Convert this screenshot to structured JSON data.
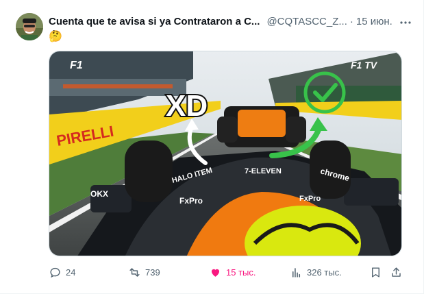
{
  "tweet": {
    "author_name": "Cuenta que te avisa si ya Contrataron a C...",
    "handle": "@CQTASCC_Z...",
    "separator": "·",
    "date": "15 июн.",
    "text": "🤔",
    "media": {
      "overlay_text": "XD",
      "logo_left": "F1",
      "logo_right": "F1 TV",
      "car_text": [
        "HALO ITEM",
        "7-ELEVEN",
        "FxPro",
        "chrome",
        "OKX",
        "FxPro"
      ],
      "wall_text": "PIRELLI"
    },
    "actions": {
      "replies": "24",
      "reposts": "739",
      "likes": "15 тыс.",
      "views": "326 тыс."
    },
    "colors": {
      "like": "#f91880",
      "muted": "#536471",
      "text": "#0f1419"
    }
  }
}
